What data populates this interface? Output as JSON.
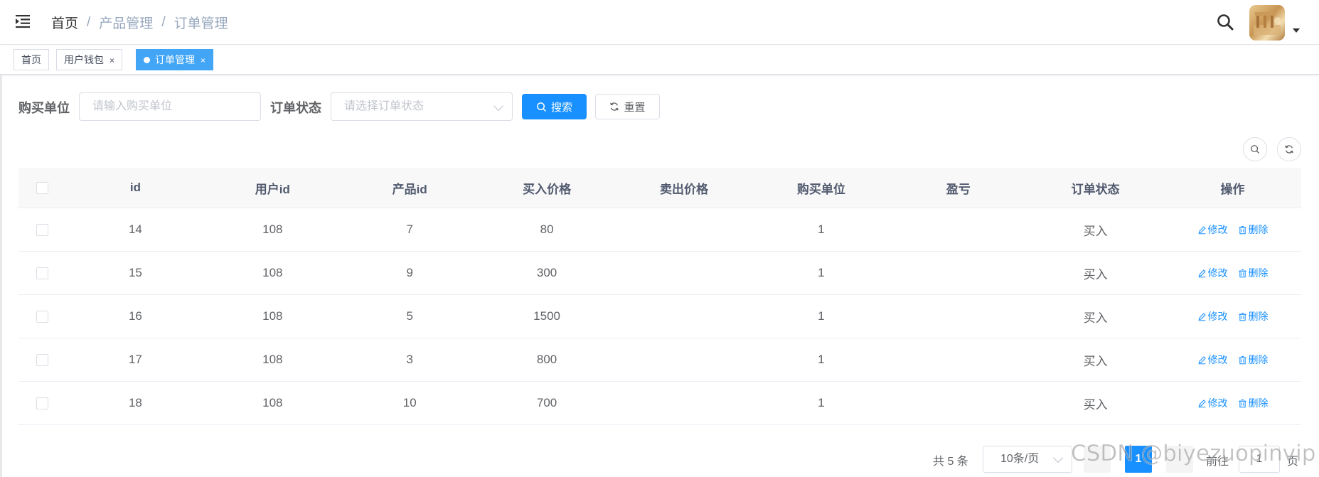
{
  "navbar": {
    "breadcrumb": [
      "首页",
      "产品管理",
      "订单管理"
    ],
    "breadcrumb_separator": "/"
  },
  "tags": [
    {
      "label": "首页",
      "closable": false,
      "active": false
    },
    {
      "label": "用户钱包",
      "closable": true,
      "active": false
    },
    {
      "label": "订单管理",
      "closable": true,
      "active": true
    }
  ],
  "tag_close_glyph": "×",
  "search_form": {
    "unit_label": "购买单位",
    "unit_placeholder": "请输入购买单位",
    "status_label": "订单状态",
    "status_placeholder": "请选择订单状态",
    "search_button": "搜索",
    "reset_button": "重置"
  },
  "table": {
    "columns": [
      "id",
      "用户id",
      "产品id",
      "买入价格",
      "卖出价格",
      "购买单位",
      "盈亏",
      "订单状态",
      "操作"
    ],
    "rows": [
      {
        "id": "14",
        "user_id": "108",
        "product_id": "7",
        "buy_price": "80",
        "sell_price": "",
        "unit": "1",
        "profit": "",
        "status": "买入"
      },
      {
        "id": "15",
        "user_id": "108",
        "product_id": "9",
        "buy_price": "300",
        "sell_price": "",
        "unit": "1",
        "profit": "",
        "status": "买入"
      },
      {
        "id": "16",
        "user_id": "108",
        "product_id": "5",
        "buy_price": "1500",
        "sell_price": "",
        "unit": "1",
        "profit": "",
        "status": "买入"
      },
      {
        "id": "17",
        "user_id": "108",
        "product_id": "3",
        "buy_price": "800",
        "sell_price": "",
        "unit": "1",
        "profit": "",
        "status": "买入"
      },
      {
        "id": "18",
        "user_id": "108",
        "product_id": "10",
        "buy_price": "700",
        "sell_price": "",
        "unit": "1",
        "profit": "",
        "status": "买入"
      }
    ],
    "edit_label": "修改",
    "delete_label": "删除"
  },
  "pagination": {
    "total": "共 5 条",
    "page_size": "10条/页",
    "current_page": "1",
    "goto_label": "前往",
    "goto_value": "1",
    "page_suffix": "页"
  },
  "watermark": "CSDN @biyezuopinvip",
  "colors": {
    "primary": "#1890ff",
    "active_tag": "#42a5f5",
    "header_bg": "#f8f8f9"
  }
}
